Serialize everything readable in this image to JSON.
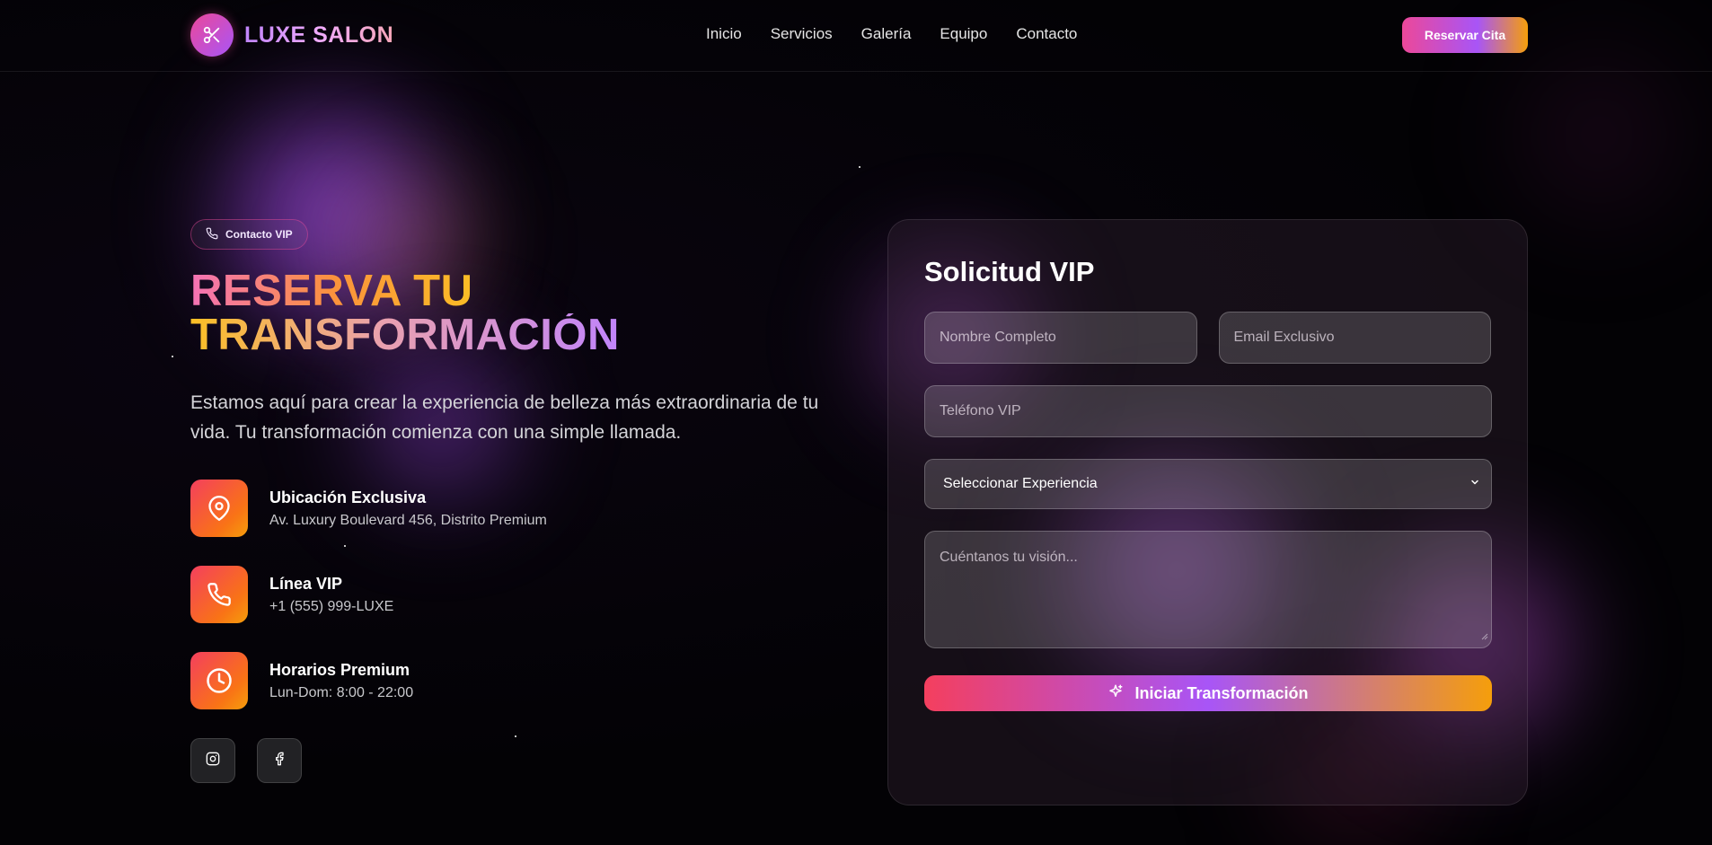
{
  "brand": {
    "name": "LUXE SALON",
    "logo_icon": "scissors-icon"
  },
  "nav": {
    "items": [
      {
        "label": "Inicio"
      },
      {
        "label": "Servicios"
      },
      {
        "label": "Galería"
      },
      {
        "label": "Equipo"
      },
      {
        "label": "Contacto"
      }
    ],
    "cta_label": "Reservar Cita"
  },
  "hero": {
    "badge_label": "Contacto VIP",
    "badge_icon": "phone-icon",
    "headline_line1": "RESERVA TU",
    "headline_line2": "TRANSFORMACIÓN",
    "description": "Estamos aquí para crear la experiencia de belleza más extraordinaria de tu vida. Tu transformación comienza con una simple llamada."
  },
  "contact_info": [
    {
      "icon": "location-pin-icon",
      "title": "Ubicación Exclusiva",
      "detail": "Av. Luxury Boulevard 456, Distrito Premium"
    },
    {
      "icon": "phone-icon",
      "title": "Línea VIP",
      "detail": "+1 (555) 999-LUXE"
    },
    {
      "icon": "clock-icon",
      "title": "Horarios Premium",
      "detail": "Lun-Dom: 8:00 - 22:00"
    }
  ],
  "social": [
    {
      "icon": "instagram-icon"
    },
    {
      "icon": "facebook-icon"
    }
  ],
  "form": {
    "title": "Solicitud VIP",
    "name_placeholder": "Nombre Completo",
    "email_placeholder": "Email Exclusivo",
    "phone_placeholder": "Teléfono VIP",
    "experience_selected": "Seleccionar Experiencia",
    "message_placeholder": "Cuéntanos tu visión...",
    "submit_label": "Iniciar Transformación",
    "submit_icon": "sparkle-icon"
  },
  "colors": {
    "accent_pink": "#ec4899",
    "accent_purple": "#a855f7",
    "accent_orange": "#f59e0b",
    "background": "#050307"
  }
}
